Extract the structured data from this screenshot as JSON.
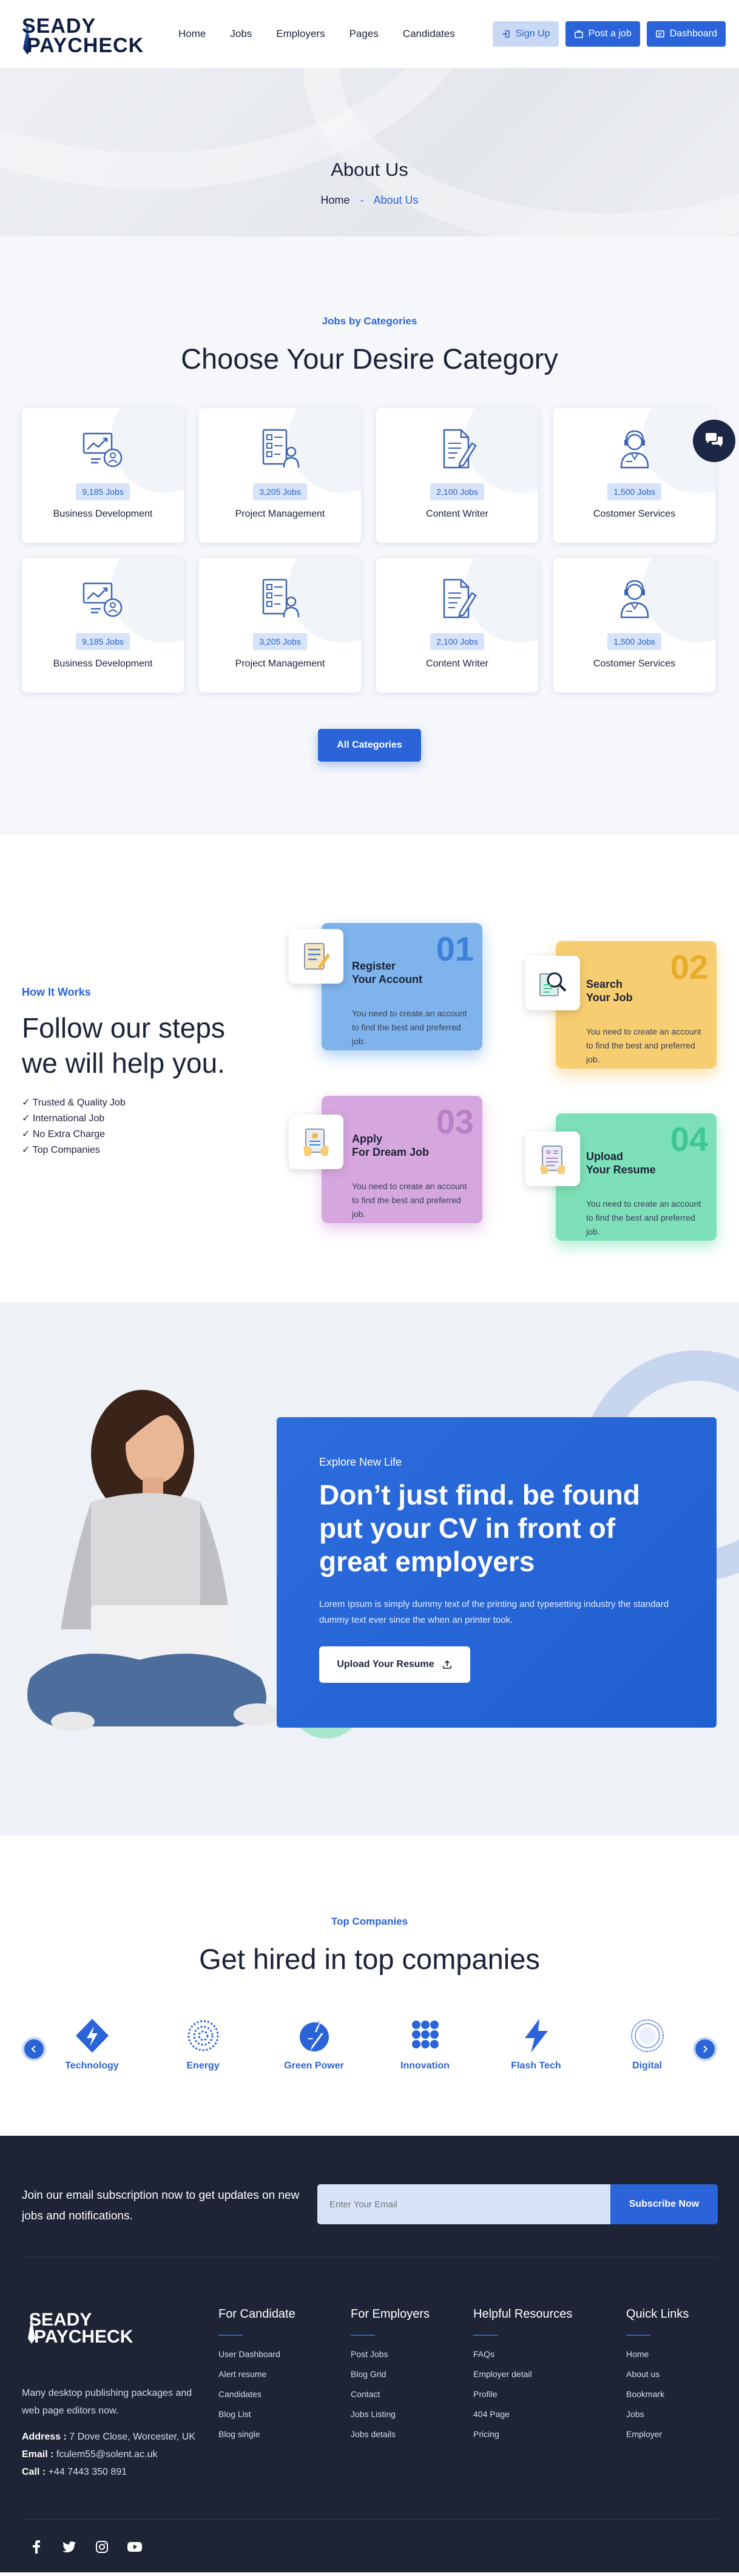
{
  "header": {
    "logo_line1": "SEADY",
    "logo_line2": "PAYCHECK",
    "nav": [
      "Home",
      "Jobs",
      "Employers",
      "Pages",
      "Candidates"
    ],
    "signup": "Sign Up",
    "post_job": "Post a job",
    "dashboard": "Dashboard"
  },
  "banner": {
    "title": "About Us",
    "crumb_home": "Home",
    "crumb_sep": "-",
    "crumb_current": "About Us"
  },
  "categories": {
    "eyebrow": "Jobs by Categories",
    "title": "Choose Your Desire Category",
    "items": [
      {
        "count": "9,185 Jobs",
        "name": "Business Development",
        "icon": "business-development-icon"
      },
      {
        "count": "3,205 Jobs",
        "name": "Project Management",
        "icon": "project-management-icon"
      },
      {
        "count": "2,100 Jobs",
        "name": "Content Writer",
        "icon": "content-writer-icon"
      },
      {
        "count": "1,500 Jobs",
        "name": "Costomer Services",
        "icon": "customer-services-icon"
      },
      {
        "count": "9,185 Jobs",
        "name": "Business Development",
        "icon": "business-development-icon"
      },
      {
        "count": "3,205 Jobs",
        "name": "Project Management",
        "icon": "project-management-icon"
      },
      {
        "count": "2,100 Jobs",
        "name": "Content Writer",
        "icon": "content-writer-icon"
      },
      {
        "count": "1,500 Jobs",
        "name": "Costomer Services",
        "icon": "customer-services-icon"
      }
    ],
    "button": "All Categories"
  },
  "how": {
    "eyebrow": "How It Works",
    "title_line1": "Follow our steps",
    "title_line2": "we will help you.",
    "bullets": [
      "Trusted & Quality Job",
      "International Job",
      "No Extra Charge",
      "Top Companies"
    ],
    "steps": [
      {
        "num": "01",
        "title1": "Register",
        "title2": "Your Account",
        "desc": "You need to create an account to find the best and preferred job.",
        "color": "#7eb3ec",
        "num_color": "#3c82d9"
      },
      {
        "num": "02",
        "title1": "Search",
        "title2": "Your Job",
        "desc": "You need to create an account to find the best and preferred job.",
        "color": "#f6cd70",
        "num_color": "#e7ac2a"
      },
      {
        "num": "03",
        "title1": "Apply",
        "title2": "For Dream Job",
        "desc": "You need to create an account to find the best and preferred job.",
        "color": "#d6a6de",
        "num_color": "#b980c6"
      },
      {
        "num": "04",
        "title1": "Upload",
        "title2": "Your Resume",
        "desc": "You need to create an account to find the best and preferred job.",
        "color": "#7ee0b8",
        "num_color": "#3ec795"
      }
    ]
  },
  "cv": {
    "eyebrow": "Explore New Life",
    "title": "Don’t just find. be found put your CV in front of great employers",
    "desc": "Lorem Ipsum is simply dummy text of the printing and typesetting industry the standard dummy text ever since the when an printer took.",
    "button": "Upload Your Resume"
  },
  "companies": {
    "eyebrow": "Top Companies",
    "title": "Get hired in top companies",
    "items": [
      {
        "name": "Technology",
        "icon": "technology-logo-icon"
      },
      {
        "name": "Energy",
        "icon": "energy-logo-icon"
      },
      {
        "name": "Green Power",
        "icon": "green-power-logo-icon"
      },
      {
        "name": "Innovation",
        "icon": "innovation-logo-icon"
      },
      {
        "name": "Flash Tech",
        "icon": "flash-tech-logo-icon"
      },
      {
        "name": "Digital",
        "icon": "digital-logo-icon"
      }
    ]
  },
  "footer": {
    "subscribe_text": "Join our email subscription now to get updates on new jobs and notifications.",
    "email_placeholder": "Enter Your Email",
    "subscribe_button": "Subscribe Now",
    "logo_line1": "SEADY",
    "logo_line2": "PAYCHECK",
    "description": "Many desktop publishing packages and web page editors now.",
    "address_label": "Address :",
    "address": "7 Dove Close, Worcester, UK",
    "email_label": "Email :",
    "email": "fculem55@solent.ac.uk",
    "call_label": "Call :",
    "call": "+44 7443 350 891",
    "columns": [
      {
        "title": "For Candidate",
        "links": [
          "User Dashboard",
          "Alert resume",
          "Candidates",
          "Blog List",
          "Blog single"
        ]
      },
      {
        "title": "For Employers",
        "links": [
          "Post Jobs",
          "Blog Grid",
          "Contact",
          "Jobs Listing",
          "Jobs details"
        ]
      },
      {
        "title": "Helpful Resources",
        "links": [
          "FAQs",
          "Employer detail",
          "Profile",
          "404 Page",
          "Pricing"
        ]
      },
      {
        "title": "Quick Links",
        "links": [
          "Home",
          "About us",
          "Bookmark",
          "Jobs",
          "Employer"
        ]
      }
    ],
    "social": [
      "facebook-icon",
      "twitter-icon",
      "instagram-icon",
      "youtube-icon"
    ]
  },
  "colors": {
    "primary": "#2a64d8",
    "dark": "#1e2336"
  }
}
